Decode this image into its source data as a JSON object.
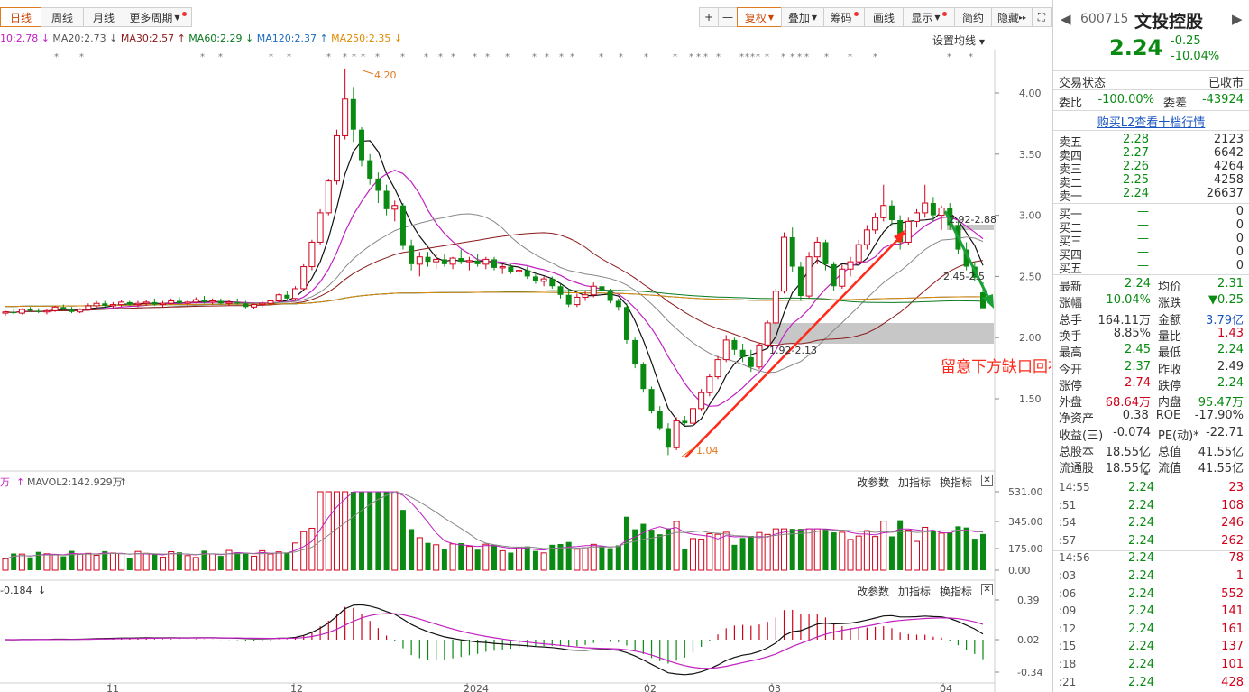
{
  "toolbar": {
    "period_tabs": [
      "日线",
      "周线",
      "月线",
      "更多周期"
    ],
    "right_tools": [
      "+",
      "—",
      "复权",
      "叠加",
      "筹码",
      "画线",
      "显示",
      "简约",
      "隐藏"
    ]
  },
  "ma_legend": {
    "ma10": "10:2.78",
    "ma20": "MA20:2.73",
    "ma30": "MA30:2.57",
    "ma60": "MA60:2.29",
    "ma120": "MA120:2.37",
    "ma250": "MA250:2.35",
    "settings": "设置均线"
  },
  "price_axis": [
    "4.00",
    "3.50",
    "3.00",
    "2.50",
    "2.00",
    "1.50"
  ],
  "annotations": {
    "high_label": "4.20",
    "low_label": "1.04",
    "mid_label": "1.92-2.13",
    "right_top_label": "2.92-2.88",
    "right_mid_label": "2.45-2.5",
    "gap_note": "留意下方缺口回补"
  },
  "volume_panel": {
    "title": "MAVOL2:142.929万",
    "unit": "万",
    "axis": [
      "531.00",
      "345.00",
      "175.00",
      "0.00"
    ],
    "tools": [
      "改参数",
      "加指标",
      "换指标"
    ]
  },
  "macd_panel": {
    "title": "-0.184",
    "axis": [
      "0.39",
      "0.02",
      "-0.34"
    ],
    "tools": [
      "改参数",
      "加指标",
      "换指标"
    ]
  },
  "x_axis": [
    "11",
    "12",
    "2024",
    "02",
    "03",
    "04"
  ],
  "stock": {
    "code": "600715",
    "name": "文投控股",
    "price": "2.24",
    "change": "-0.25",
    "change_pct": "-10.04%",
    "trade_status_label": "交易状态",
    "trade_status": "已收市",
    "weibi_label": "委比",
    "weibi": "-100.00%",
    "weicha_label": "委差",
    "weicha": "-43924",
    "l2_link": "购买L2查看十档行情"
  },
  "order_book": {
    "asks": [
      {
        "label": "卖五",
        "price": "2.28",
        "vol": "2123"
      },
      {
        "label": "卖四",
        "price": "2.27",
        "vol": "6642"
      },
      {
        "label": "卖三",
        "price": "2.26",
        "vol": "4264"
      },
      {
        "label": "卖二",
        "price": "2.25",
        "vol": "4258"
      },
      {
        "label": "卖一",
        "price": "2.24",
        "vol": "26637"
      }
    ],
    "bids": [
      {
        "label": "买一",
        "price": "—",
        "vol": "0"
      },
      {
        "label": "买二",
        "price": "—",
        "vol": "0"
      },
      {
        "label": "买三",
        "price": "—",
        "vol": "0"
      },
      {
        "label": "买四",
        "price": "—",
        "vol": "0"
      },
      {
        "label": "买五",
        "price": "—",
        "vol": "0"
      }
    ]
  },
  "quote_stats": [
    {
      "l1": "最新",
      "v1": "2.24",
      "c1": "green",
      "l2": "均价",
      "v2": "2.31",
      "c2": "green"
    },
    {
      "l1": "涨幅",
      "v1": "-10.04%",
      "c1": "green",
      "l2": "涨跌",
      "v2": "▼0.25",
      "c2": "green"
    },
    {
      "l1": "总手",
      "v1": "164.11万",
      "c1": "dark",
      "l2": "金额",
      "v2": "3.79亿",
      "c2": "blue"
    },
    {
      "l1": "换手",
      "v1": "8.85%",
      "c1": "dark",
      "l2": "量比",
      "v2": "1.43",
      "c2": "red"
    },
    {
      "l1": "最高",
      "v1": "2.45",
      "c1": "green",
      "l2": "最低",
      "v2": "2.24",
      "c2": "green"
    },
    {
      "l1": "今开",
      "v1": "2.37",
      "c1": "green",
      "l2": "昨收",
      "v2": "2.49",
      "c2": "dark"
    },
    {
      "l1": "涨停",
      "v1": "2.74",
      "c1": "red",
      "l2": "跌停",
      "v2": "2.24",
      "c2": "green"
    },
    {
      "l1": "外盘",
      "v1": "68.64万",
      "c1": "red",
      "l2": "内盘",
      "v2": "95.47万",
      "c2": "green"
    },
    {
      "l1": "净资产",
      "v1": "0.38",
      "c1": "dark",
      "l2": "ROE",
      "v2": "-17.90%",
      "c2": "dark"
    },
    {
      "l1": "收益(三)",
      "v1": "-0.074",
      "c1": "dark",
      "l2": "PE(动)*",
      "v2": "-22.71",
      "c2": "dark"
    },
    {
      "l1": "总股本",
      "v1": "18.55亿",
      "c1": "dark",
      "l2": "总值",
      "v2": "41.55亿",
      "c2": "dark"
    },
    {
      "l1": "流通股",
      "v1": "18.55亿",
      "c1": "dark",
      "l2": "流值",
      "v2": "41.55亿",
      "c2": "dark"
    }
  ],
  "ticks": [
    {
      "time": "14:55",
      "price": "2.24",
      "vol": "23"
    },
    {
      "time": ":51",
      "price": "2.24",
      "vol": "108"
    },
    {
      "time": ":54",
      "price": "2.24",
      "vol": "246"
    },
    {
      "time": ":57",
      "price": "2.24",
      "vol": "262"
    },
    {
      "time": "14:56",
      "price": "2.24",
      "vol": "78"
    },
    {
      "time": ":03",
      "price": "2.24",
      "vol": "1"
    },
    {
      "time": ":06",
      "price": "2.24",
      "vol": "552"
    },
    {
      "time": ":09",
      "price": "2.24",
      "vol": "141"
    },
    {
      "time": ":12",
      "price": "2.24",
      "vol": "161"
    },
    {
      "time": ":15",
      "price": "2.24",
      "vol": "137"
    },
    {
      "time": ":18",
      "price": "2.24",
      "vol": "101"
    },
    {
      "time": ":21",
      "price": "2.24",
      "vol": "428"
    }
  ],
  "colors": {
    "up": "#d0021b",
    "down": "#0a8a12",
    "accent": "#e07a1f"
  }
}
